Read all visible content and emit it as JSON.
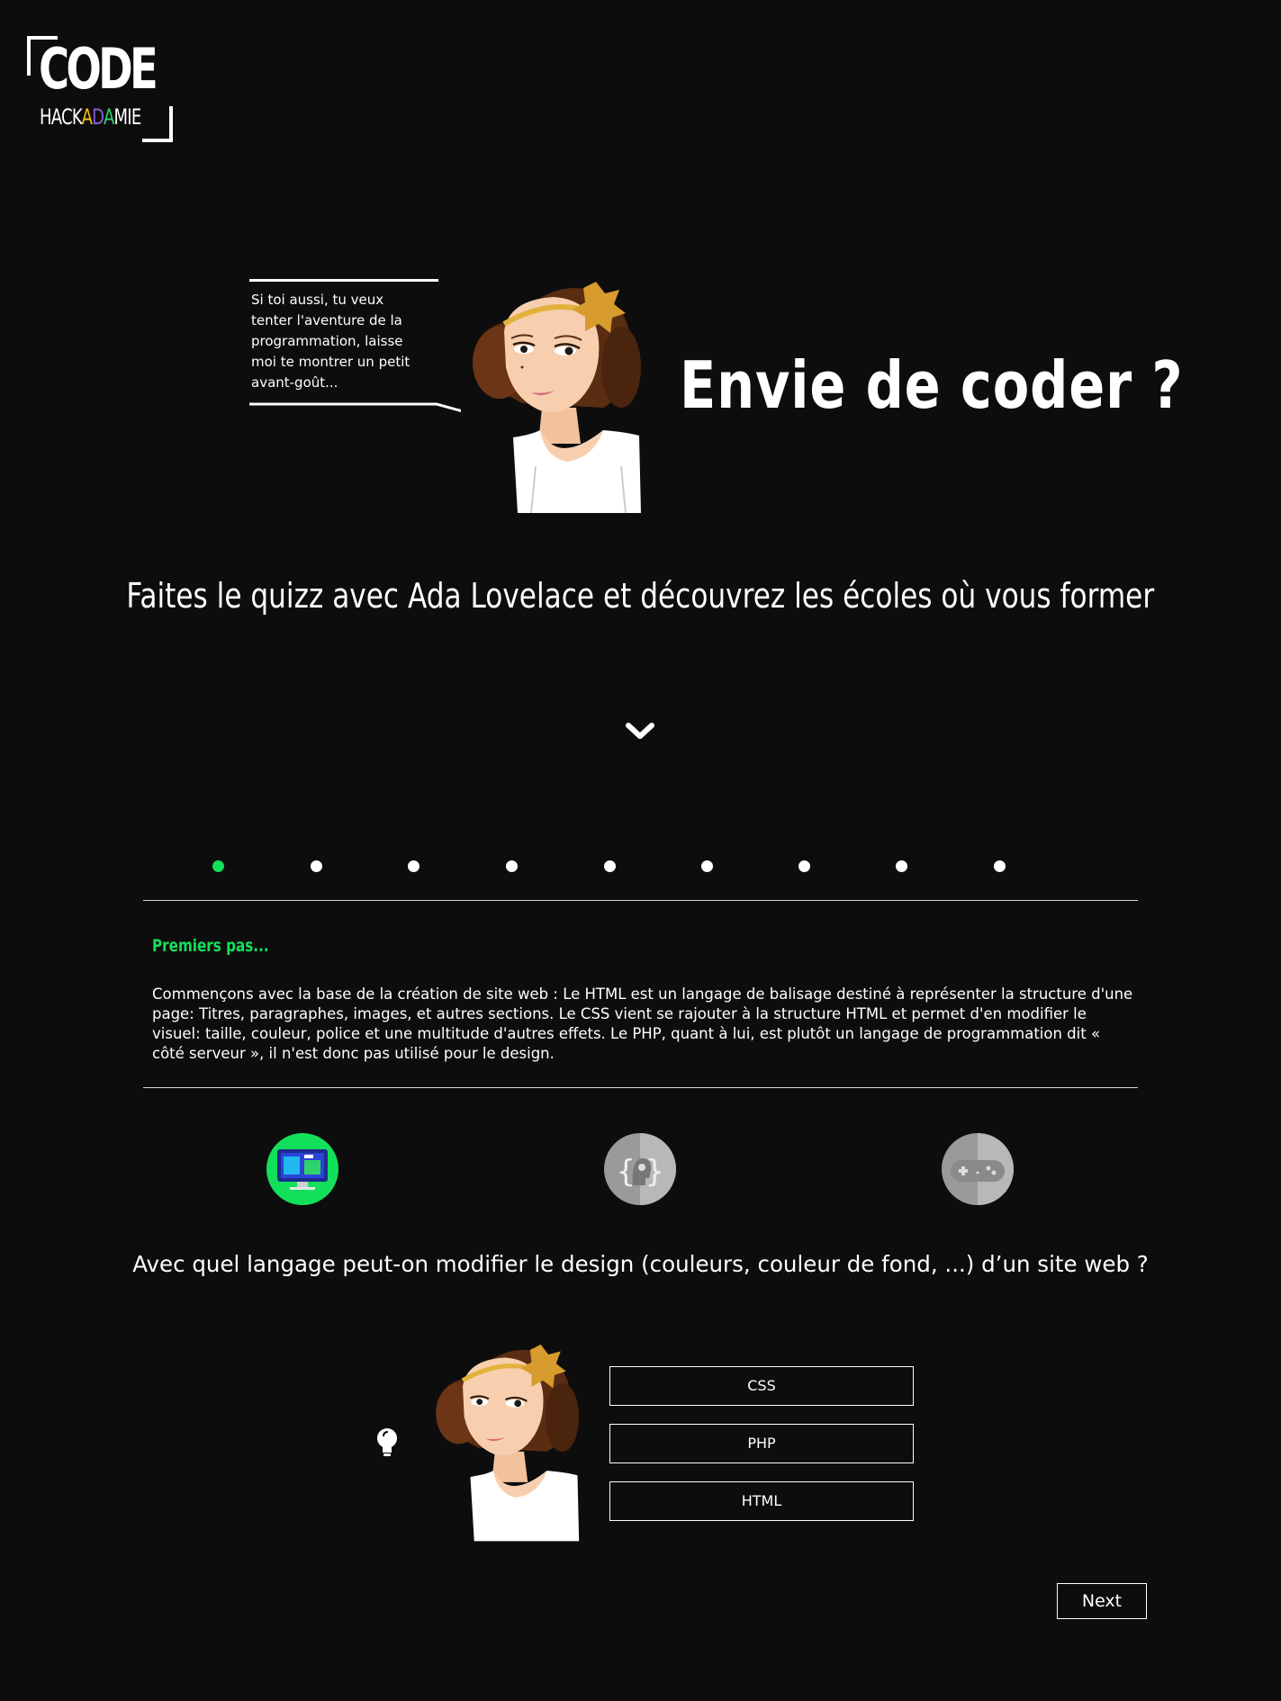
{
  "logo": {
    "word": "CODE",
    "sub_prefix": "HACK",
    "sub_letters": [
      "A",
      "D",
      "A"
    ],
    "sub_suffix": "MIE",
    "letter_colors": [
      "#f4c20d",
      "#8e5bd6",
      "#2fd36b"
    ]
  },
  "hero": {
    "bubble_text": "Si toi aussi, tu veux tenter l'aventure de la programmation, laisse moi te montrer un petit avant-goût...",
    "title": "Envie de coder ?",
    "subtitle": "Faites le quizz avec Ada Lovelace et découvrez les écoles où vous former"
  },
  "progress": {
    "total": 9,
    "current": 1,
    "active_color": "#13e05a"
  },
  "step": {
    "title": "Premiers pas...",
    "body": "Commençons avec la base de la création de site web : Le HTML est un langage de balisage destiné à représenter la structure d'une page: Titres, paragraphes, images, et autres sections. Le CSS vient se rajouter à la structure HTML et permet d'en modifier le visuel: taille, couleur, police et une multitude d'autres effets. Le PHP, quant à lui, est plutôt un langage de programmation dit « côté serveur », il n'est donc pas utilisé pour le design."
  },
  "categories": [
    {
      "icon": "web-design-icon",
      "active": true
    },
    {
      "icon": "code-brain-icon",
      "active": false
    },
    {
      "icon": "gamepad-icon",
      "active": false
    }
  ],
  "quiz": {
    "question": "Avec quel langage peut-on modifier le design (couleurs, couleur de fond, ...) d’un site web ?",
    "answers": [
      "CSS",
      "PHP",
      "HTML"
    ],
    "hint_icon": "lightbulb-icon"
  },
  "nav": {
    "next_label": "Next"
  },
  "colors": {
    "background": "#0d0d0d",
    "accent": "#13e05a"
  }
}
